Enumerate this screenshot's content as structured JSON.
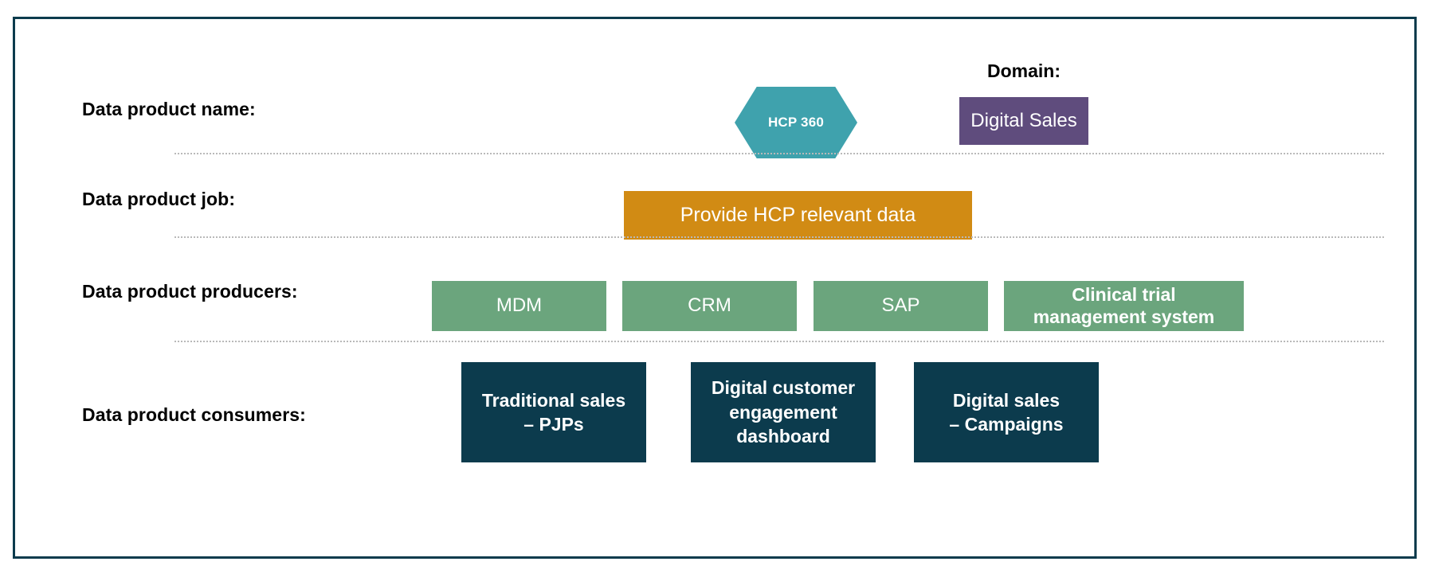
{
  "frame": {
    "border_color": "#0c3b4d"
  },
  "palette": {
    "hexagon": "#3fa2ad",
    "domain_badge": "#5f4c7d",
    "job_bar": "#d18b14",
    "producer_box": "#6ba57d",
    "consumer_box": "#0c3b4d",
    "separator": "#b9b9b9",
    "text_on_fill": "#ffffff",
    "label_text": "#000000"
  },
  "rows": {
    "name": {
      "label": "Data product name:",
      "product": "HCP 360",
      "domain_label": "Domain:",
      "domain_value": "Digital Sales"
    },
    "job": {
      "label": "Data product job:",
      "value": "Provide HCP relevant data"
    },
    "producers": {
      "label": "Data product producers:",
      "items": [
        {
          "line1": "MDM",
          "line2": ""
        },
        {
          "line1": "CRM",
          "line2": ""
        },
        {
          "line1": "SAP",
          "line2": ""
        },
        {
          "line1": "Clinical trial",
          "line2": "management system"
        }
      ]
    },
    "consumers": {
      "label": "Data product consumers:",
      "items": [
        {
          "line1": "Traditional sales",
          "line2": "– PJPs",
          "line3": ""
        },
        {
          "line1": "Digital customer",
          "line2": "engagement",
          "line3": "dashboard"
        },
        {
          "line1": "Digital sales",
          "line2": "– Campaigns",
          "line3": ""
        }
      ]
    }
  }
}
